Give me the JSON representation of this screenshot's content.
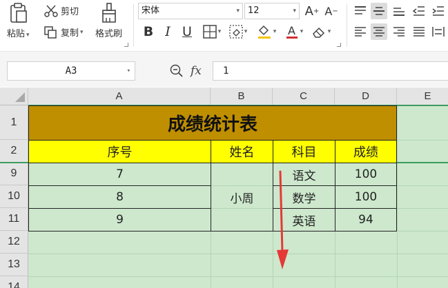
{
  "ribbon": {
    "paste_label": "粘贴",
    "cut_label": "剪切",
    "copy_label": "复制",
    "format_painter_label": "格式刷",
    "font_name": "宋体",
    "font_size": "12",
    "bold_label": "B",
    "italic_label": "I",
    "underline_label": "U",
    "font_color": "#d32f2f",
    "fill_color": "#f5c400"
  },
  "formula_bar": {
    "cell_ref": "A3",
    "fx_label": "fx",
    "formula": "1"
  },
  "columns": [
    "A",
    "B",
    "C",
    "D",
    "E"
  ],
  "rows": [
    "1",
    "2",
    "9",
    "10",
    "11",
    "12",
    "13",
    "14"
  ],
  "sheet": {
    "title": "成绩统计表",
    "headers": [
      "序号",
      "姓名",
      "科目",
      "成绩"
    ],
    "records": [
      {
        "seq": "7",
        "subject": "语文",
        "score": "100"
      },
      {
        "seq": "8",
        "subject": "数学",
        "score": "100"
      },
      {
        "seq": "9",
        "subject": "英语",
        "score": "94"
      }
    ],
    "name": "小周"
  },
  "colors": {
    "title_fill": "#bf8f00",
    "header_fill": "#ffff00",
    "sheet_bg": "#cde8cd",
    "arrow": "#e53935"
  }
}
